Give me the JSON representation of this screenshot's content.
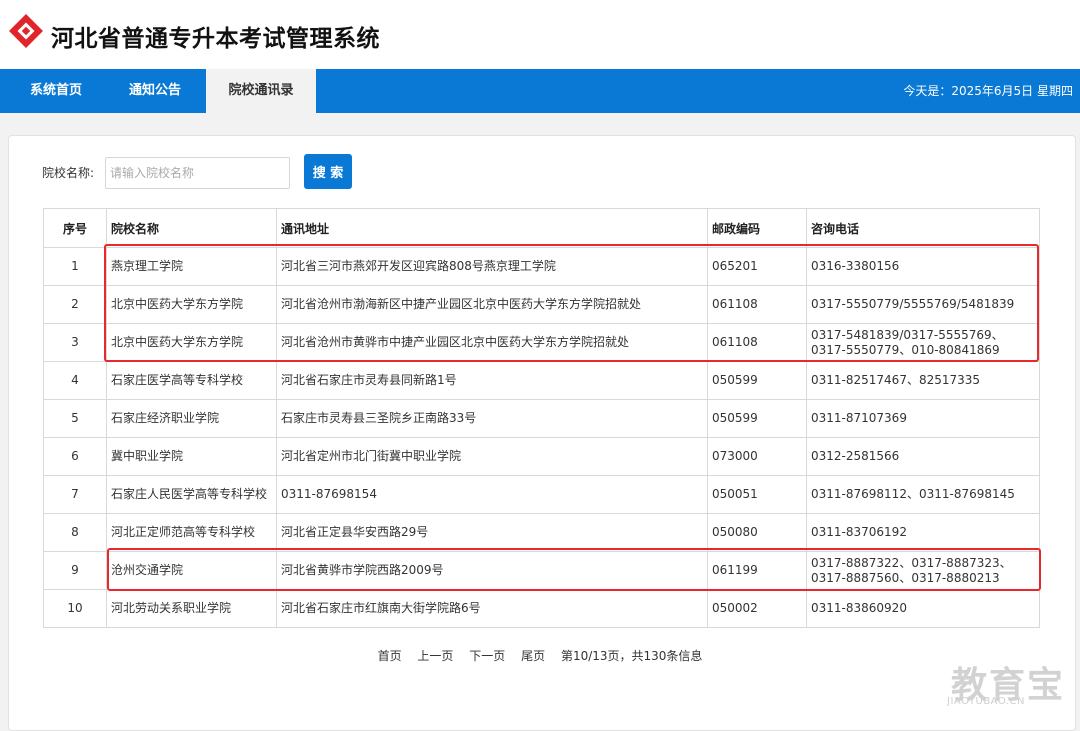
{
  "app": {
    "title": "河北省普通专升本考试管理系统"
  },
  "nav": {
    "items": [
      {
        "label": "系统首页"
      },
      {
        "label": "通知公告"
      },
      {
        "label": "院校通讯录"
      }
    ],
    "active_index": 2,
    "date_text": "今天是：2025年6月5日 星期四"
  },
  "search": {
    "label": "院校名称:",
    "value": "",
    "placeholder": "请输入院校名称",
    "button_label": "搜 索"
  },
  "table": {
    "headers": [
      "序号",
      "院校名称",
      "通讯地址",
      "邮政编码",
      "咨询电话"
    ],
    "rows": [
      {
        "idx": "1",
        "name": "燕京理工学院",
        "address": "河北省三河市燕郊开发区迎宾路808号燕京理工学院",
        "postcode": "065201",
        "phone": "0316-3380156"
      },
      {
        "idx": "2",
        "name": "北京中医药大学东方学院",
        "address": "河北省沧州市渤海新区中捷产业园区北京中医药大学东方学院招就处",
        "postcode": "061108",
        "phone": "0317-5550779/5555769/5481839"
      },
      {
        "idx": "3",
        "name": "北京中医药大学东方学院",
        "address": "河北省沧州市黄骅市中捷产业园区北京中医药大学东方学院招就处",
        "postcode": "061108",
        "phone": "0317-5481839/0317-5555769、0317-5550779、010-80841869"
      },
      {
        "idx": "4",
        "name": "石家庄医学高等专科学校",
        "address": "河北省石家庄市灵寿县同新路1号",
        "postcode": "050599",
        "phone": "0311-82517467、82517335"
      },
      {
        "idx": "5",
        "name": "石家庄经济职业学院",
        "address": "石家庄市灵寿县三圣院乡正南路33号",
        "postcode": "050599",
        "phone": "0311-87107369"
      },
      {
        "idx": "6",
        "name": "冀中职业学院",
        "address": "河北省定州市北门街冀中职业学院",
        "postcode": "073000",
        "phone": "0312-2581566"
      },
      {
        "idx": "7",
        "name": "石家庄人民医学高等专科学校",
        "address": "0311-87698154",
        "postcode": "050051",
        "phone": "0311-87698112、0311-87698145"
      },
      {
        "idx": "8",
        "name": "河北正定师范高等专科学校",
        "address": "河北省正定县华安西路29号",
        "postcode": "050080",
        "phone": "0311-83706192"
      },
      {
        "idx": "9",
        "name": "沧州交通学院",
        "address": "河北省黄骅市学院西路2009号",
        "postcode": "061199",
        "phone": "0317-8887322、0317-8887323、0317-8887560、0317-8880213"
      },
      {
        "idx": "10",
        "name": "河北劳动关系职业学院",
        "address": "河北省石家庄市红旗南大街学院路6号",
        "postcode": "050002",
        "phone": "0311-83860920"
      }
    ]
  },
  "pager": {
    "first": "首页",
    "prev": "上一页",
    "next": "下一页",
    "last": "尾页",
    "info": "第10/13页，共130条信息"
  },
  "watermark": {
    "title": "教育宝",
    "subtitle": "JIAOYUBAO.CN"
  },
  "colors": {
    "nav_blue": "#0a79d6",
    "logo_red": "#e0262a",
    "highlight_red": "#e8292b"
  },
  "icons": {
    "logo": "diamond-logo-icon"
  }
}
